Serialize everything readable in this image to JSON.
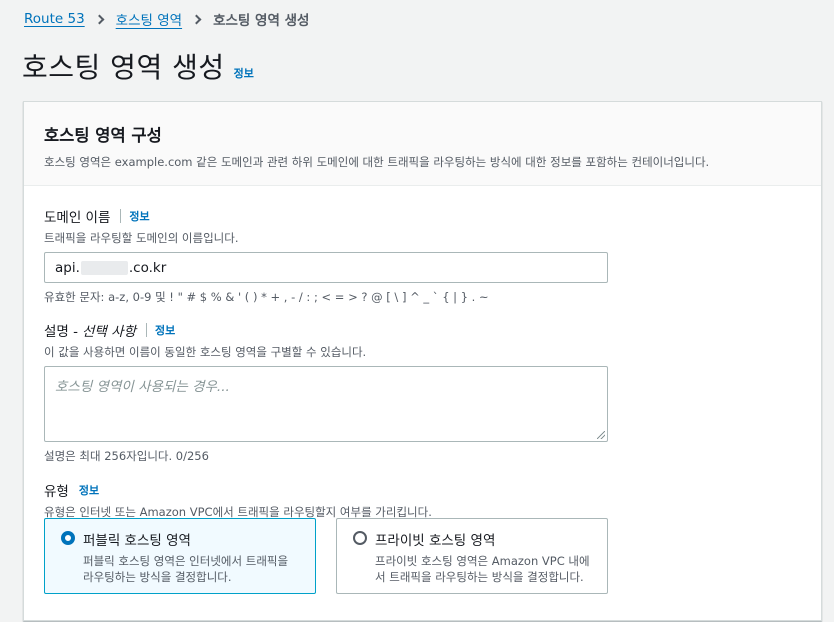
{
  "breadcrumb": {
    "items": [
      "Route 53",
      "호스팅 영역"
    ],
    "current": "호스팅 영역 생성"
  },
  "page": {
    "title": "호스팅 영역 생성",
    "info": "정보"
  },
  "panel": {
    "title": "호스팅 영역 구성",
    "description": "호스팅 영역은 example.com 같은 도메인과 관련 하위 도메인에 대한 트래픽을 라우팅하는 방식에 대한 정보를 포함하는 컨테이너입니다."
  },
  "domain": {
    "label": "도메인 이름",
    "info": "정보",
    "hint": "트래픽을 라우팅할 도메인의 이름입니다.",
    "value_prefix": "api.",
    "value_suffix": ".co.kr",
    "constraint": "유효한 문자: a-z, 0-9 및 ! \" # $ % & ' ( ) * + , - / : ; < = > ? @ [ \\ ] ^ _ ` { | } . ~"
  },
  "description_field": {
    "label": "설명 - ",
    "label_optional": "선택 사항",
    "info": "정보",
    "hint": "이 값을 사용하면 이름이 동일한 호스팅 영역을 구별할 수 있습니다.",
    "placeholder": "호스팅 영역이 사용되는 경우...",
    "counter": "설명은 최대 256자입니다. 0/256"
  },
  "type": {
    "label": "유형",
    "info": "정보",
    "hint": "유형은 인터넷 또는 Amazon VPC에서 트래픽을 라우팅할지 여부를 가리킵니다.",
    "options": [
      {
        "title": "퍼블릭 호스팅 영역",
        "desc_line1": "퍼블릭 호스팅 영역은 인터넷에서 트래픽을",
        "desc_line2": "라우팅하는 방식을 결정합니다.",
        "selected": true
      },
      {
        "title": "프라이빗 호스팅 영역",
        "desc_line1": "프라이빗 호스팅 영역은 Amazon VPC 내에",
        "desc_line2": "서 트래픽을 라우팅하는 방식을 결정합니다.",
        "selected": false
      }
    ]
  },
  "colors": {
    "link": "#0073bb",
    "selected_border": "#00a1c9",
    "selected_bg": "#f1faff"
  }
}
